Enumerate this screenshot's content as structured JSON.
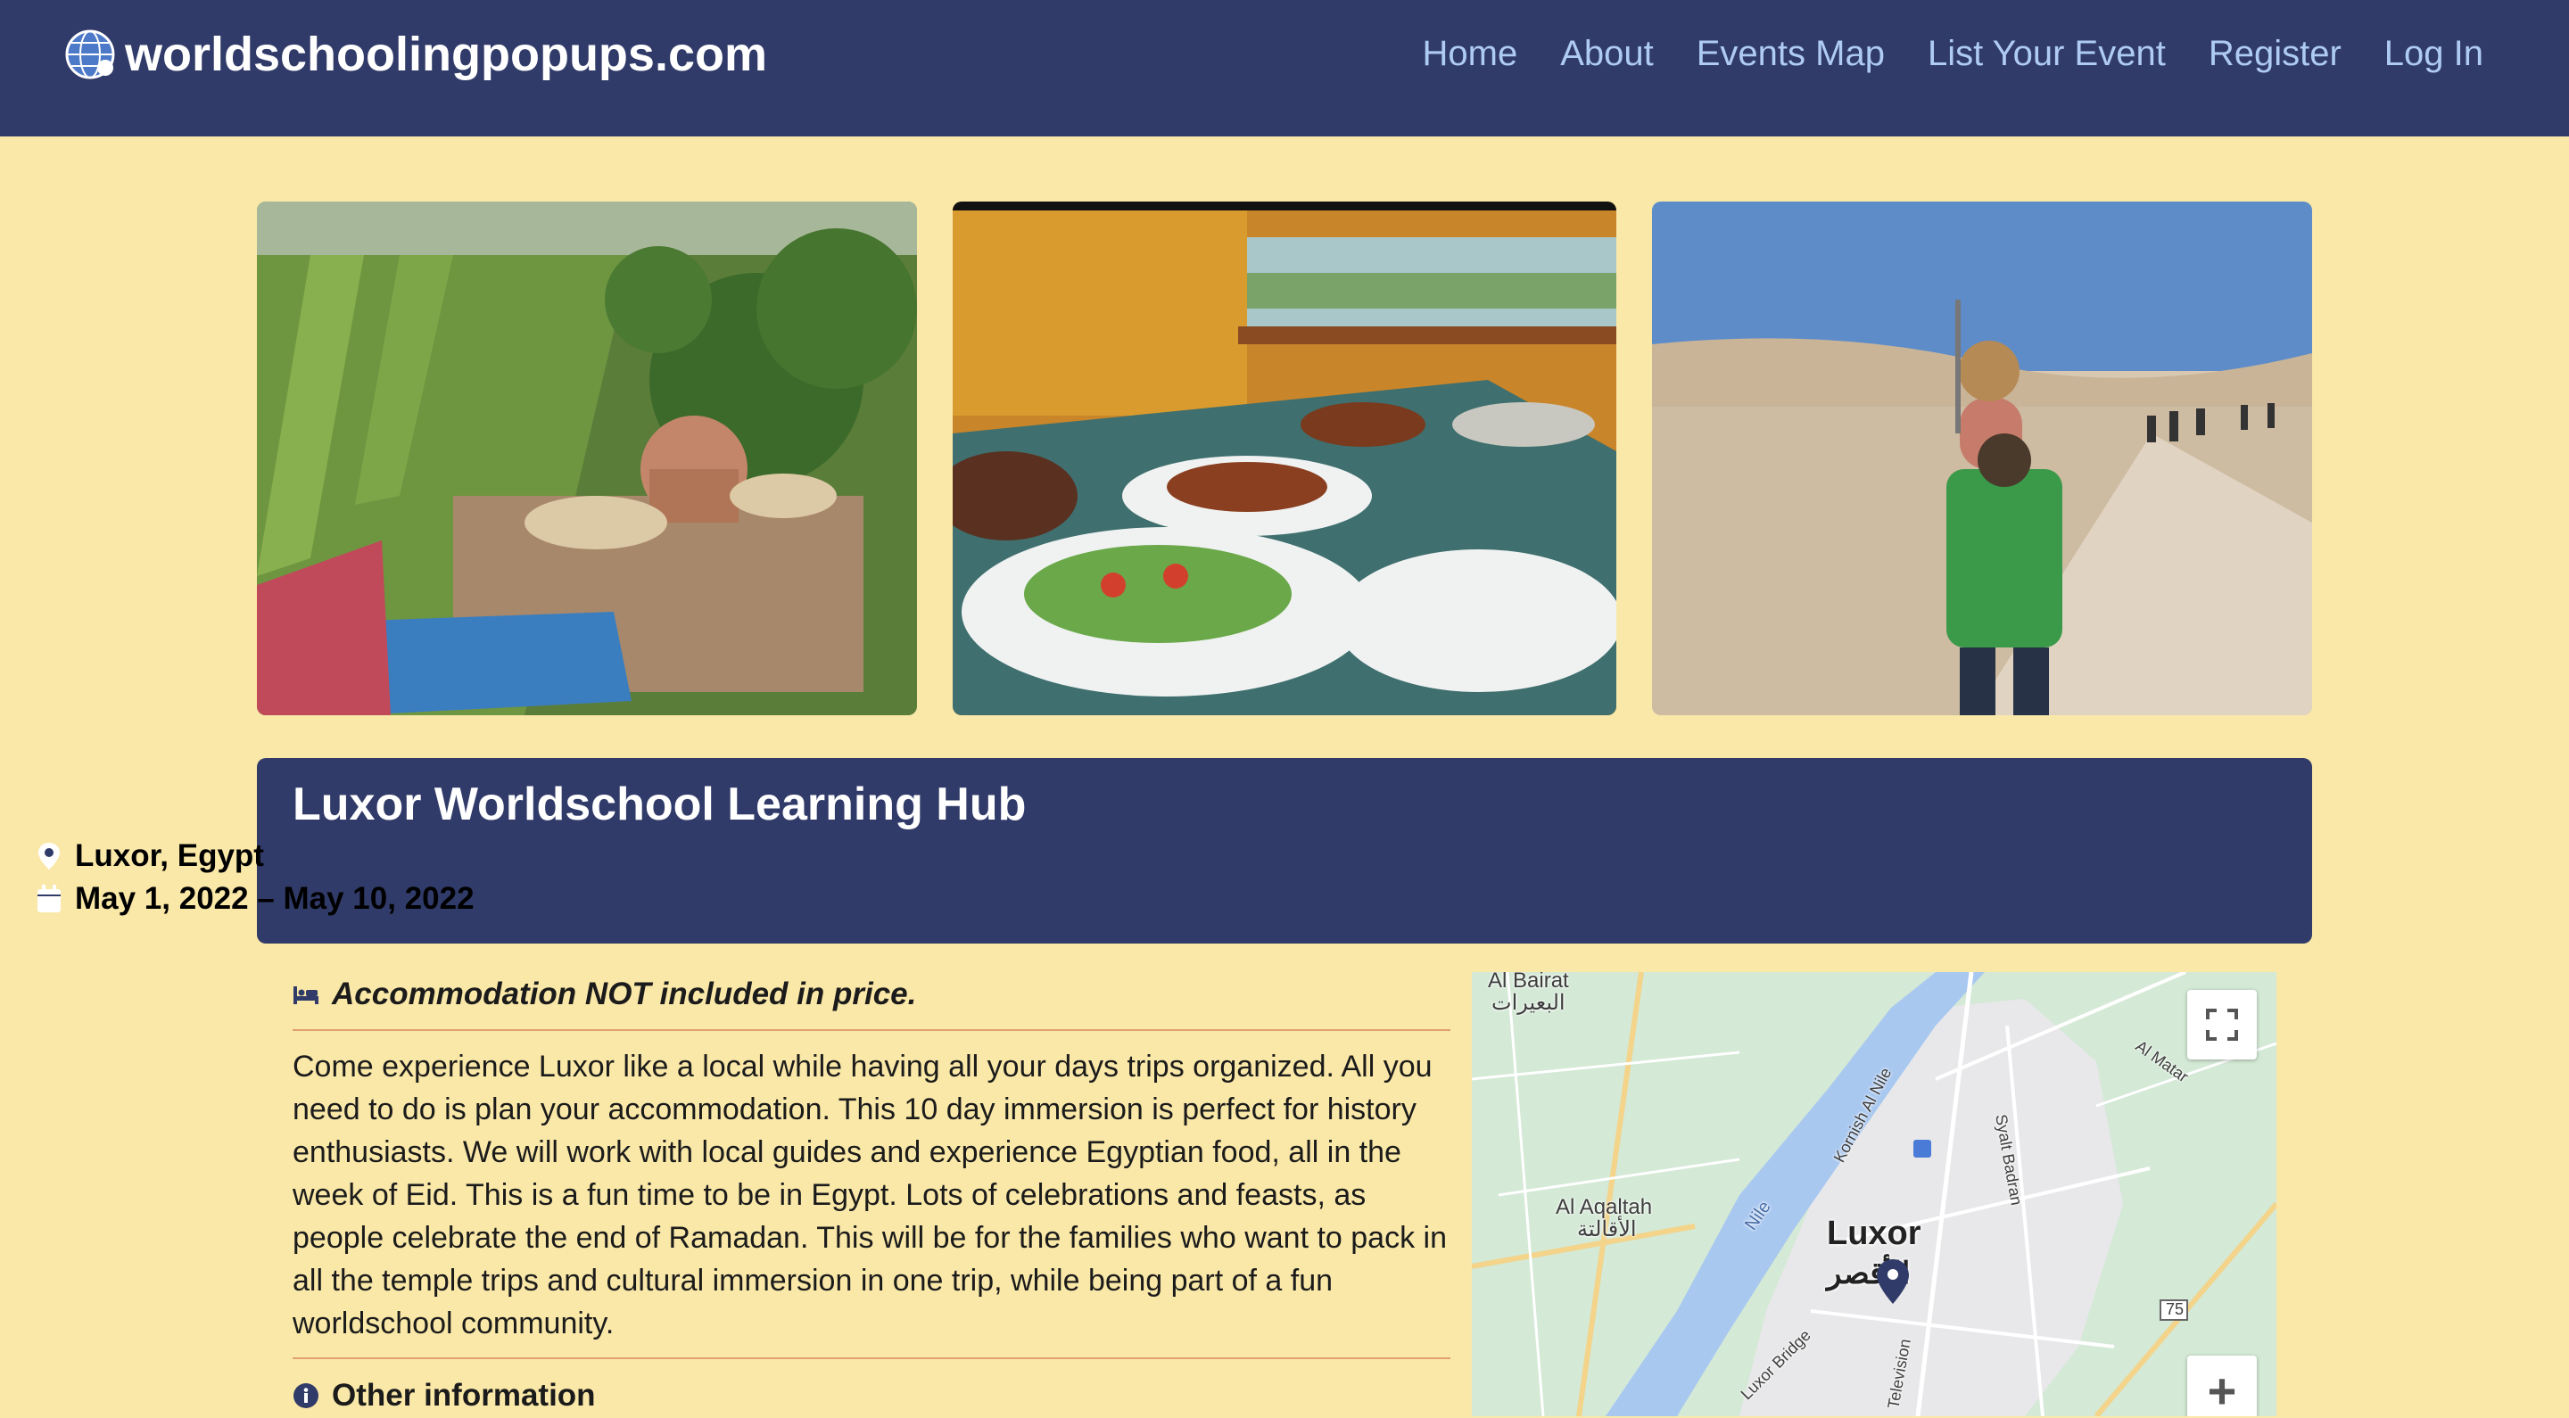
{
  "navbar": {
    "brand": "worldschoolingpopups.com",
    "links": [
      "Home",
      "About",
      "Events Map",
      "List Your Event",
      "Register",
      "Log In"
    ]
  },
  "event": {
    "title": "Luxor Worldschool Learning Hub",
    "location": "Luxor, Egypt",
    "dates": "May 1, 2022 – May 10, 2022",
    "accommodation": "Accommodation NOT included in price.",
    "description": "Come experience Luxor like a local while having all your days trips organized. All you need to do is plan your accommodation. This 10 day immersion is perfect for history enthusiasts. We will work with local guides and experience Egyptian food, all in the week of Eid. This is a fun time to be in Egypt. Lots of celebrations and feasts, as people celebrate the end of Ramadan. This will be for the families who want to pack in all the temple trips and cultural immersion in one trip, while being part of a fun worldschool community.",
    "other_heading": "Other information"
  },
  "map": {
    "labels": {
      "bairat_en": "Al Bairat",
      "bairat_ar": "البعيرات",
      "aqaltah_en": "Al Aqaltah",
      "aqaltah_ar": "الأقالتة",
      "nile": "Nile",
      "kornish": "Kornish Al Nile",
      "sayed": "Syalt Badran",
      "almatar": "Al Matar",
      "luxor_bridge": "Luxor Bridge",
      "television": "Television",
      "road": "75",
      "city_en": "Luxor",
      "city_ar": "الأقصر"
    },
    "zoom_in": "+",
    "fullscreen_icon": "fullscreen-icon"
  },
  "colors": {
    "navbar_bg": "#313b69",
    "page_bg": "#fae8a8",
    "nav_link": "#aecbf2",
    "rule": "#e0a070"
  }
}
